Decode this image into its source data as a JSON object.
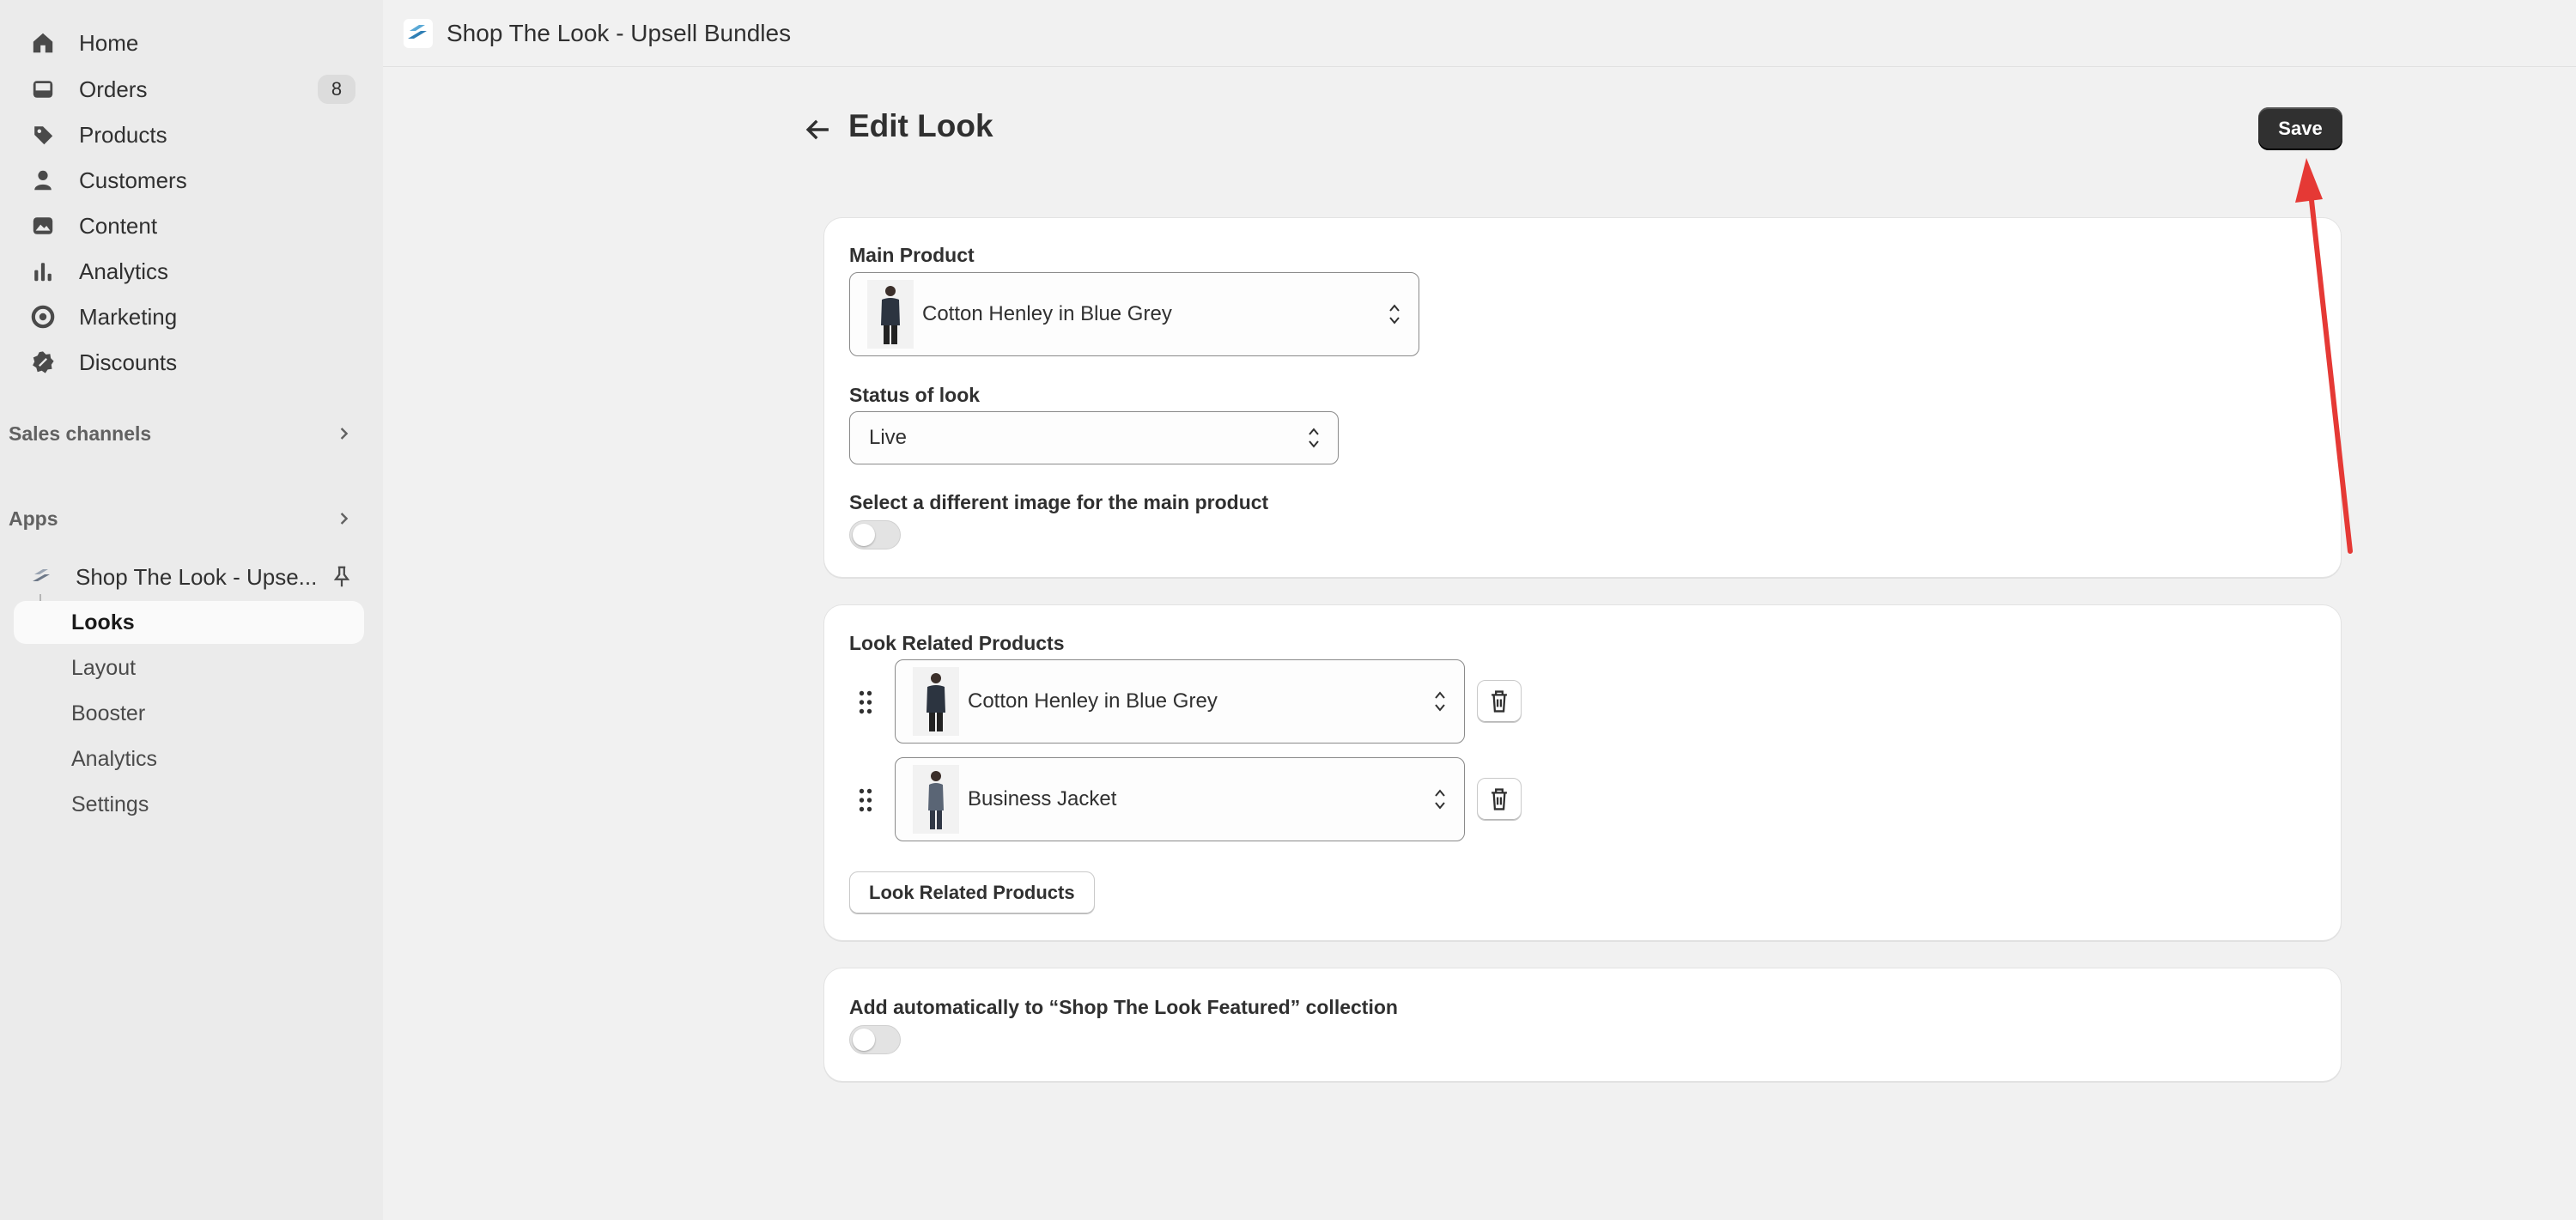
{
  "sidebar": {
    "nav": [
      {
        "label": "Home",
        "icon": "home-icon"
      },
      {
        "label": "Orders",
        "icon": "inbox-icon",
        "badge": "8"
      },
      {
        "label": "Products",
        "icon": "tag-icon"
      },
      {
        "label": "Customers",
        "icon": "person-icon"
      },
      {
        "label": "Content",
        "icon": "image-icon"
      },
      {
        "label": "Analytics",
        "icon": "bar-chart-icon"
      },
      {
        "label": "Marketing",
        "icon": "target-icon"
      },
      {
        "label": "Discounts",
        "icon": "discount-icon"
      }
    ],
    "sales_channels": "Sales channels",
    "apps": "Apps",
    "app_name": "Shop The Look - Upse...",
    "app_subnav": [
      "Looks",
      "Layout",
      "Booster",
      "Analytics",
      "Settings"
    ]
  },
  "topbar": {
    "title": "Shop The Look - Upsell Bundles"
  },
  "page": {
    "title": "Edit Look",
    "save_label": "Save"
  },
  "main_card": {
    "main_product_label": "Main Product",
    "main_product_value": "Cotton Henley in Blue Grey",
    "status_label": "Status of look",
    "status_value": "Live",
    "image_toggle_label": "Select a different image for the main product"
  },
  "related_card": {
    "label": "Look Related Products",
    "products": [
      "Cotton Henley in Blue Grey",
      "Business Jacket"
    ],
    "add_button_label": "Look Related Products"
  },
  "collection_card": {
    "label": "Add automatically to “Shop The Look Featured” collection"
  },
  "colors": {
    "accent_annotation": "#e53935",
    "save_bg": "#303030"
  }
}
